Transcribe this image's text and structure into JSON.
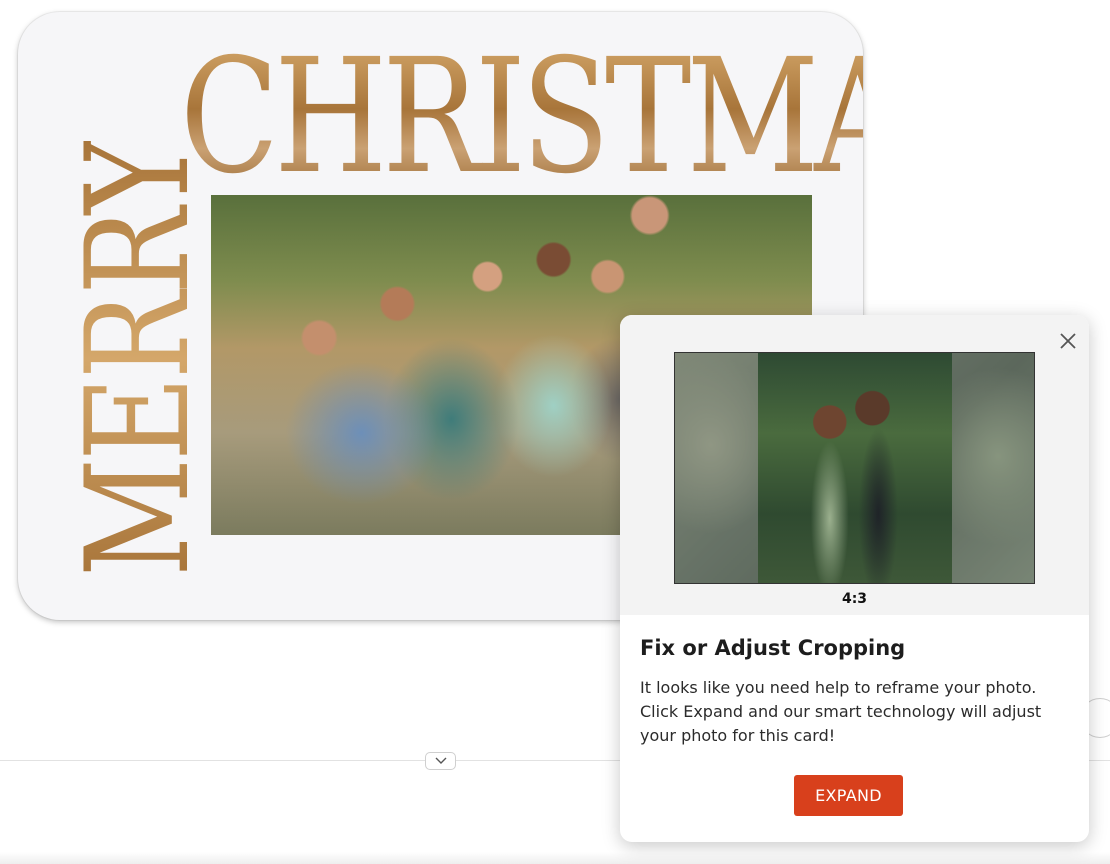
{
  "card": {
    "greeting_top": "CHRISTMAS",
    "greeting_side": "MERRY"
  },
  "popup": {
    "ratio_label": "4:3",
    "title": "Fix or Adjust Cropping",
    "body": "It looks like you need help to reframe your photo. Click Expand and our smart technology will adjust your photo for this card!",
    "button_label": "EXPAND",
    "close_icon": "close-icon"
  },
  "colors": {
    "accent": "#d8401c",
    "foil": "#b98a4b"
  }
}
